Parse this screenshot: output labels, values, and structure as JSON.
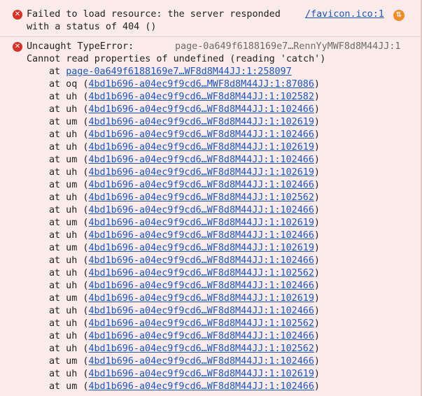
{
  "error1": {
    "icon": "error-circle-x-icon",
    "line1": "Failed to load resource: the server responded",
    "line2": "with a status of 404 ()",
    "source": "/favicon.ico:1",
    "network_icon": "network-request-icon"
  },
  "error2": {
    "icon": "error-circle-x-icon",
    "title": "Uncaught TypeError:",
    "source": "page-0a649f6188169e7…RennYyMWF8d8M44JJ:1",
    "message": "Cannot read properties of undefined (reading 'catch')",
    "frame0": {
      "prefix": "at ",
      "link": "page-0a649f6188169e7…WF8d8M44JJ:1:258097"
    },
    "frames": [
      {
        "fn": "at oq",
        "link": "4bd1b696-a04ec9f9cd6…MWF8d8M44JJ:1:87086"
      },
      {
        "fn": "at uh",
        "link": "4bd1b696-a04ec9f9cd6…WF8d8M44JJ:1:102582"
      },
      {
        "fn": "at uh",
        "link": "4bd1b696-a04ec9f9cd6…WF8d8M44JJ:1:102466"
      },
      {
        "fn": "at um",
        "link": "4bd1b696-a04ec9f9cd6…WF8d8M44JJ:1:102619"
      },
      {
        "fn": "at uh",
        "link": "4bd1b696-a04ec9f9cd6…WF8d8M44JJ:1:102466"
      },
      {
        "fn": "at uh",
        "link": "4bd1b696-a04ec9f9cd6…WF8d8M44JJ:1:102619"
      },
      {
        "fn": "at um",
        "link": "4bd1b696-a04ec9f9cd6…WF8d8M44JJ:1:102466"
      },
      {
        "fn": "at uh",
        "link": "4bd1b696-a04ec9f9cd6…WF8d8M44JJ:1:102619"
      },
      {
        "fn": "at um",
        "link": "4bd1b696-a04ec9f9cd6…WF8d8M44JJ:1:102466"
      },
      {
        "fn": "at uh",
        "link": "4bd1b696-a04ec9f9cd6…WF8d8M44JJ:1:102562"
      },
      {
        "fn": "at uh",
        "link": "4bd1b696-a04ec9f9cd6…WF8d8M44JJ:1:102466"
      },
      {
        "fn": "at um",
        "link": "4bd1b696-a04ec9f9cd6…WF8d8M44JJ:1:102619"
      },
      {
        "fn": "at uh",
        "link": "4bd1b696-a04ec9f9cd6…WF8d8M44JJ:1:102466"
      },
      {
        "fn": "at um",
        "link": "4bd1b696-a04ec9f9cd6…WF8d8M44JJ:1:102619"
      },
      {
        "fn": "at uh",
        "link": "4bd1b696-a04ec9f9cd6…WF8d8M44JJ:1:102466"
      },
      {
        "fn": "at uh",
        "link": "4bd1b696-a04ec9f9cd6…WF8d8M44JJ:1:102562"
      },
      {
        "fn": "at uh",
        "link": "4bd1b696-a04ec9f9cd6…WF8d8M44JJ:1:102466"
      },
      {
        "fn": "at um",
        "link": "4bd1b696-a04ec9f9cd6…WF8d8M44JJ:1:102619"
      },
      {
        "fn": "at uh",
        "link": "4bd1b696-a04ec9f9cd6…WF8d8M44JJ:1:102466"
      },
      {
        "fn": "at uh",
        "link": "4bd1b696-a04ec9f9cd6…WF8d8M44JJ:1:102562"
      },
      {
        "fn": "at uh",
        "link": "4bd1b696-a04ec9f9cd6…WF8d8M44JJ:1:102466"
      },
      {
        "fn": "at uh",
        "link": "4bd1b696-a04ec9f9cd6…WF8d8M44JJ:1:102562"
      },
      {
        "fn": "at um",
        "link": "4bd1b696-a04ec9f9cd6…WF8d8M44JJ:1:102466"
      },
      {
        "fn": "at uh",
        "link": "4bd1b696-a04ec9f9cd6…WF8d8M44JJ:1:102619"
      },
      {
        "fn": "at um",
        "link": "4bd1b696-a04ec9f9cd6…WF8d8M44JJ:1:102466"
      }
    ]
  },
  "colors": {
    "background": "#fcebeb",
    "error_icon": "#d93025",
    "link": "#1a56c8",
    "network_icon": "#f28b27"
  }
}
